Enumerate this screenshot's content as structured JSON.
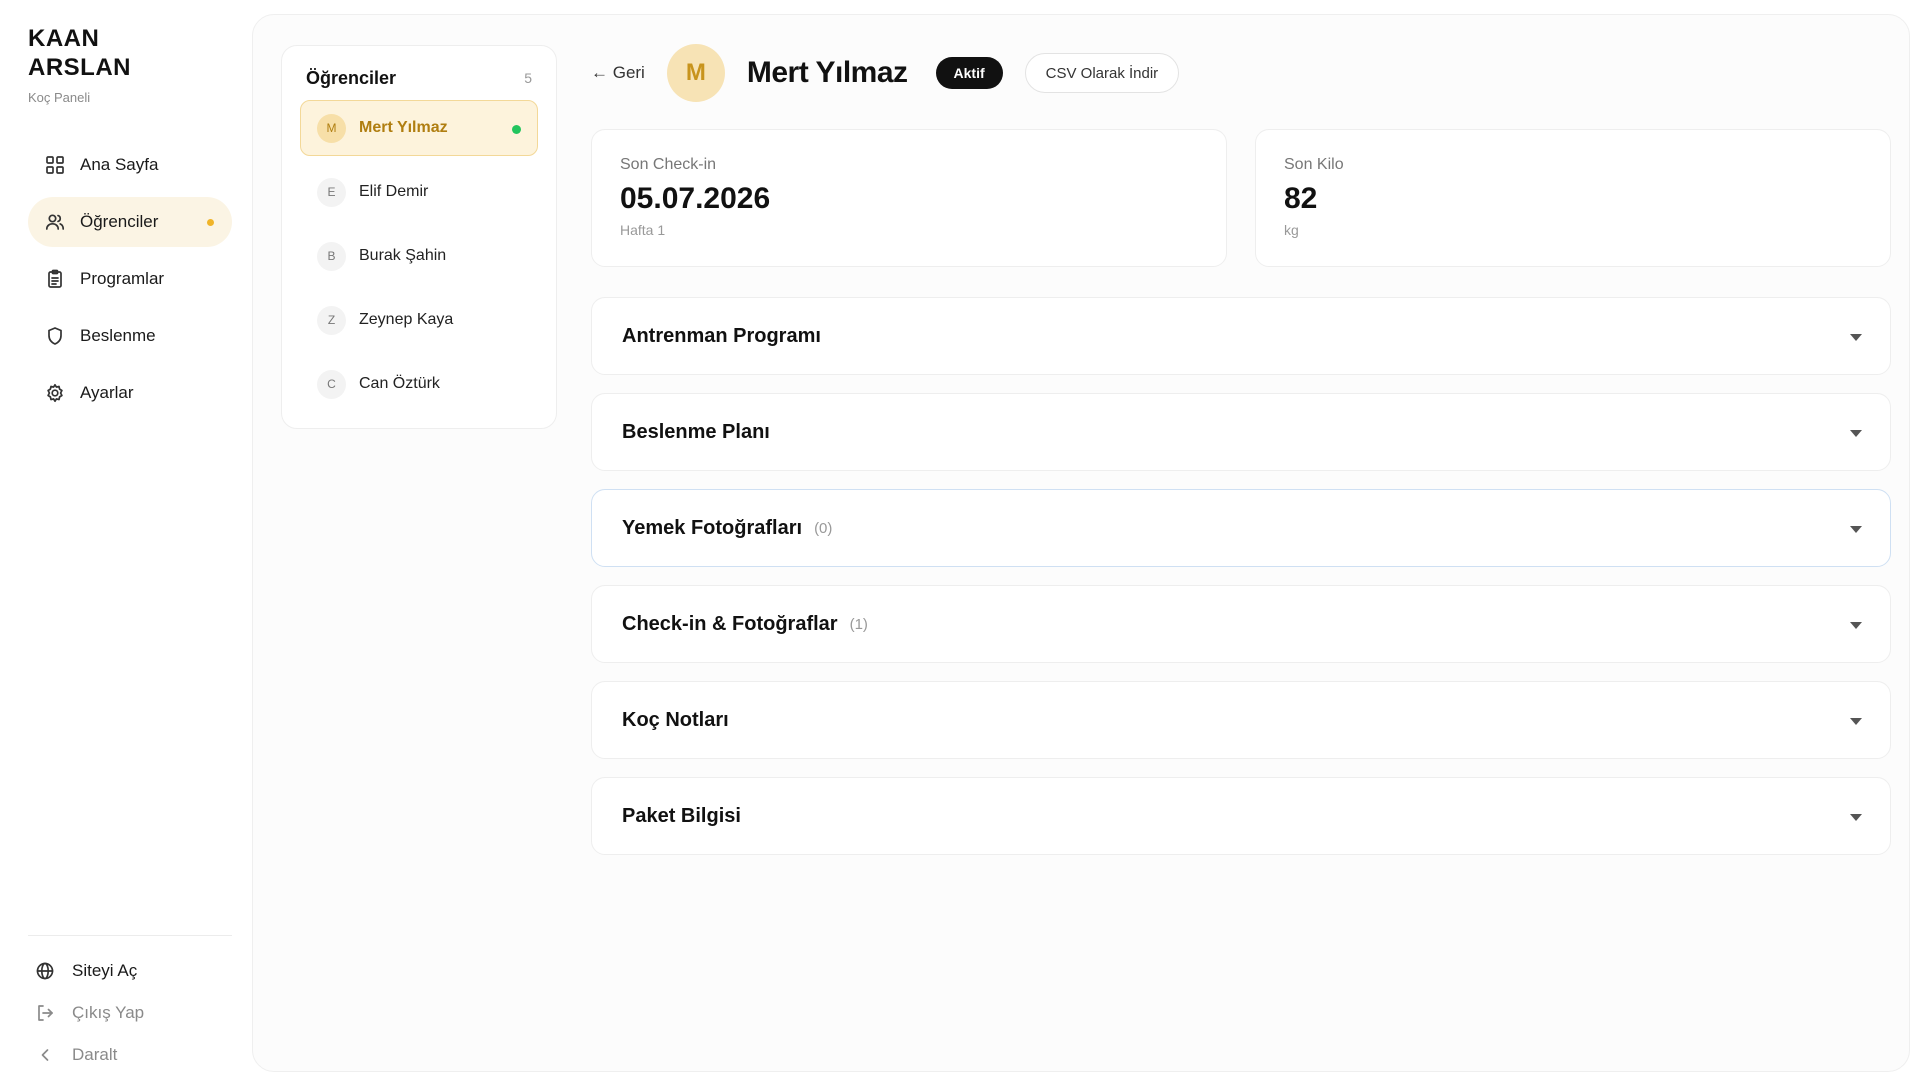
{
  "brand": {
    "name": "KAAN ARSLAN",
    "subtitle": "Koç Paneli"
  },
  "nav": {
    "items": [
      {
        "label": "Ana Sayfa",
        "icon": "grid-icon"
      },
      {
        "label": "Öğrenciler",
        "icon": "users-icon",
        "active": true
      },
      {
        "label": "Programlar",
        "icon": "clipboard-icon"
      },
      {
        "label": "Beslenme",
        "icon": "shield-icon"
      },
      {
        "label": "Ayarlar",
        "icon": "gear-icon"
      }
    ],
    "bottom": [
      {
        "label": "Siteyi Aç",
        "icon": "globe-icon"
      },
      {
        "label": "Çıkış Yap",
        "icon": "logout-icon"
      },
      {
        "label": "Daralt",
        "icon": "chevron-left-icon"
      }
    ]
  },
  "students": {
    "title": "Öğrenciler",
    "count": "5",
    "list": [
      {
        "initial": "M",
        "name": "Mert Yılmaz",
        "active": true,
        "online": true
      },
      {
        "initial": "E",
        "name": "Elif Demir"
      },
      {
        "initial": "B",
        "name": "Burak Şahin"
      },
      {
        "initial": "Z",
        "name": "Zeynep Kaya"
      },
      {
        "initial": "C",
        "name": "Can Öztürk"
      }
    ]
  },
  "detail": {
    "back_label": "← Geri",
    "avatar_initial": "M",
    "name": "Mert Yılmaz",
    "status": "Aktif",
    "csv_label": "CSV Olarak İndir",
    "stats": [
      {
        "label": "Son Check-in",
        "value": "05.07.2026",
        "sub": "Hafta 1"
      },
      {
        "label": "Son Kilo",
        "value": "82",
        "sub": "kg"
      }
    ],
    "sections": [
      {
        "title": "Antrenman Programı",
        "count": ""
      },
      {
        "title": "Beslenme Planı",
        "count": ""
      },
      {
        "title": "Yemek Fotoğrafları",
        "count": "(0)"
      },
      {
        "title": "Check-in & Fotoğraflar",
        "count": "(1)"
      },
      {
        "title": "Koç Notları",
        "count": ""
      },
      {
        "title": "Paket Bilgisi",
        "count": ""
      }
    ]
  },
  "colors": {
    "accent": "#f0b429",
    "active_bg": "#fbf4e4",
    "online": "#22c55e",
    "badge_bg": "#111111"
  }
}
